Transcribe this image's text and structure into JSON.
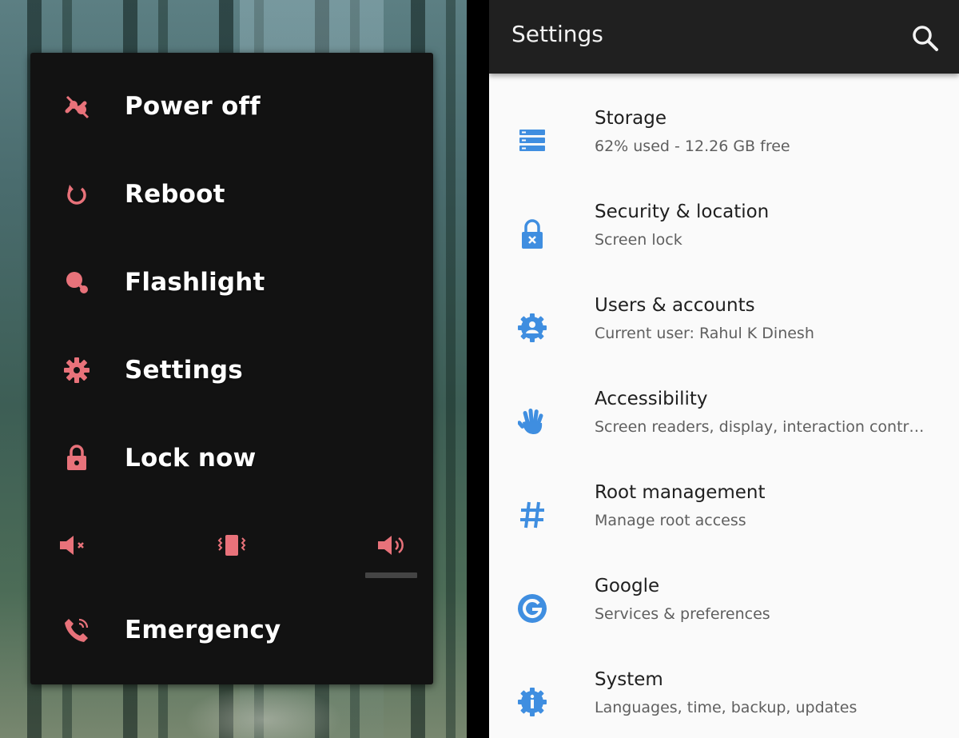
{
  "power_menu": {
    "items": [
      {
        "label": "Power off",
        "icon": "power-off-icon"
      },
      {
        "label": "Reboot",
        "icon": "reboot-icon"
      },
      {
        "label": "Flashlight",
        "icon": "flashlight-icon"
      },
      {
        "label": "Settings",
        "icon": "settings-gear-icon"
      },
      {
        "label": "Lock now",
        "icon": "lock-icon"
      }
    ],
    "volume_modes": [
      "mute-icon",
      "vibrate-icon",
      "sound-on-icon"
    ],
    "selected_volume_mode": "sound-on-icon",
    "emergency": {
      "label": "Emergency",
      "icon": "emergency-phone-icon"
    },
    "accent_color": "#e8727a",
    "panel_color": "#121212"
  },
  "settings": {
    "title": "Settings",
    "search_icon": "search-icon",
    "accent_color": "#3f8ee0",
    "items": [
      {
        "title": "Storage",
        "subtitle": "62% used - 12.26 GB free",
        "icon": "storage-icon"
      },
      {
        "title": "Security & location",
        "subtitle": "Screen lock",
        "icon": "security-lock-icon"
      },
      {
        "title": "Users & accounts",
        "subtitle": "Current user: Rahul K Dinesh",
        "icon": "users-icon"
      },
      {
        "title": "Accessibility",
        "subtitle": "Screen readers, display, interaction contr…",
        "icon": "accessibility-hand-icon"
      },
      {
        "title": "Root management",
        "subtitle": "Manage root access",
        "icon": "hash-icon"
      },
      {
        "title": "Google",
        "subtitle": "Services & preferences",
        "icon": "google-icon"
      },
      {
        "title": "System",
        "subtitle": "Languages, time, backup, updates",
        "icon": "system-info-icon"
      }
    ]
  }
}
